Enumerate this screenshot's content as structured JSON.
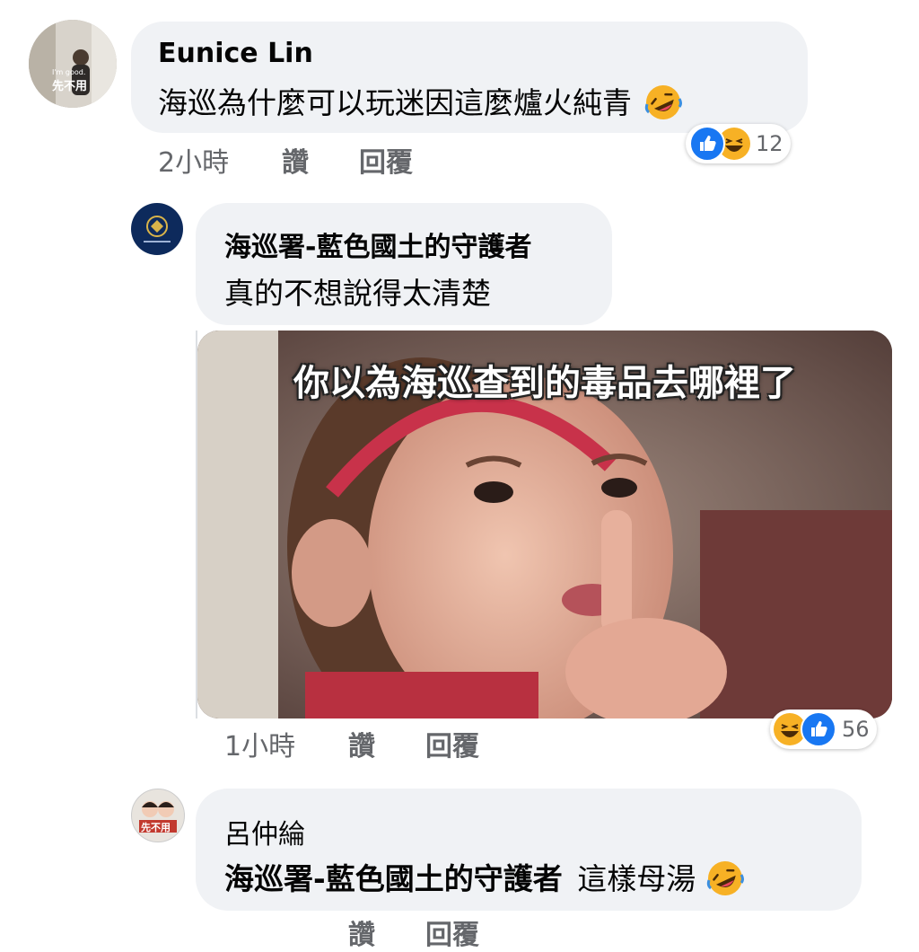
{
  "comments": [
    {
      "author": "Eunice Lin",
      "text": "海巡為什麼可以玩迷因這麼爐火純青",
      "avatar_text": "先不用",
      "avatar_subtext": "I'm good.",
      "time": "2小時",
      "like_label": "讚",
      "reply_label": "回覆",
      "reaction_count": "12"
    },
    {
      "author": "海巡署-藍色國土的守護者",
      "text": "真的不想說得太清楚",
      "meme_caption": "你以為海巡查到的毒品去哪裡了",
      "time": "1小時",
      "like_label": "讚",
      "reply_label": "回覆",
      "reaction_count": "56"
    },
    {
      "author": "呂仲綸",
      "avatar_text": "先不用",
      "mention": "海巡署-藍色國土的守護者",
      "text": "這樣母湯",
      "time": "",
      "like_label": "讚",
      "reply_label": "回覆"
    }
  ],
  "colors": {
    "bubble": "#f0f2f5",
    "like_blue": "#1877f2",
    "haha_yellow": "#f7b125",
    "meta_gray": "#65676b"
  },
  "icons": [
    "like-icon",
    "haha-icon",
    "rofl-emoji"
  ]
}
